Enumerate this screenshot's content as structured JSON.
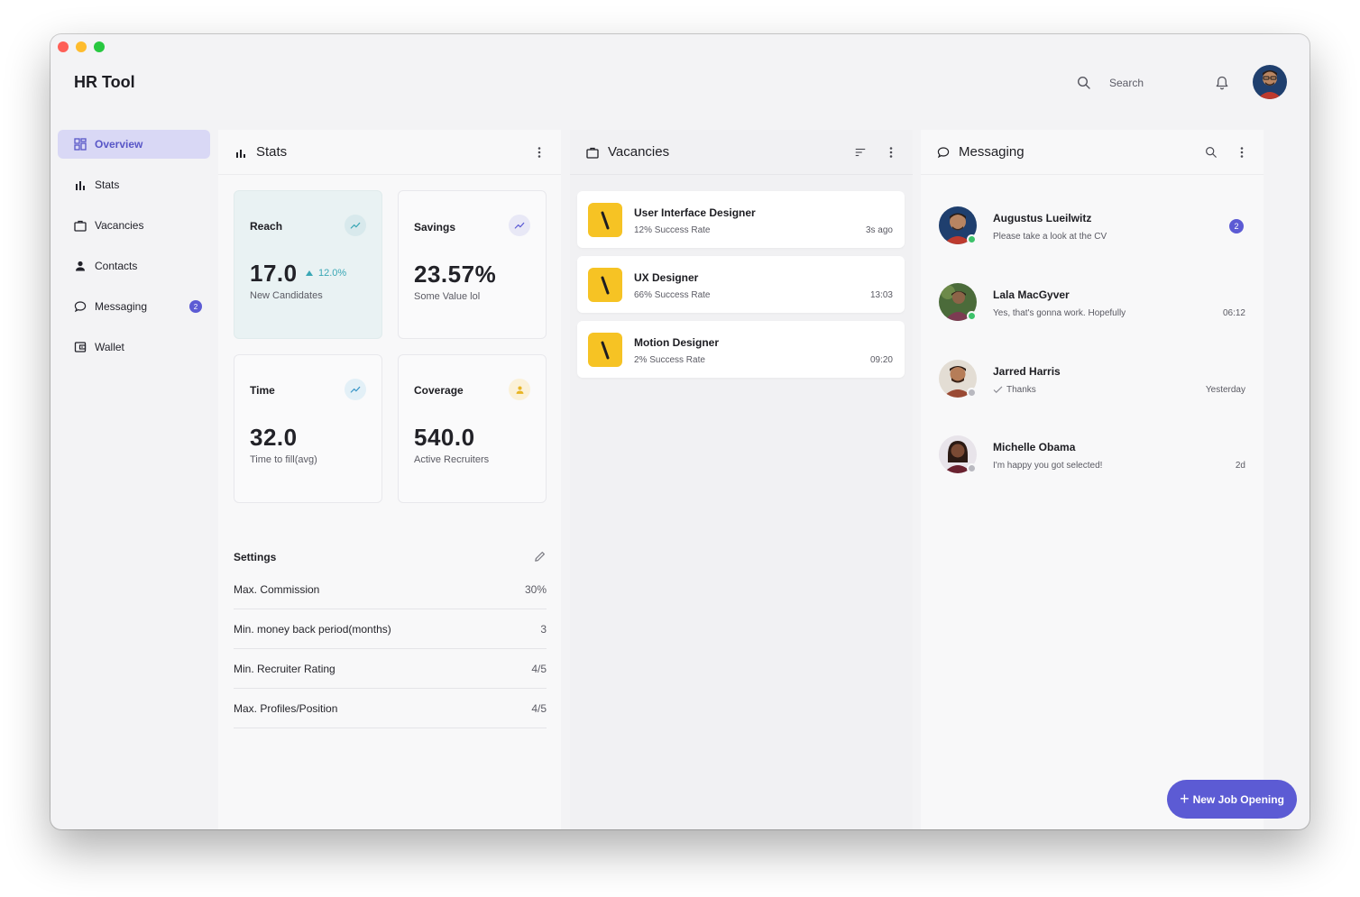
{
  "app": {
    "title": "HR Tool",
    "search_placeholder": "Search"
  },
  "colors": {
    "accent": "#5c5bd4",
    "sidebar_active_bg": "#d9d8f5",
    "vacancy_logo": "#f6c324",
    "online": "#3cc26a",
    "offline": "#b9b9c0",
    "reach_bg": "#e9f2f3"
  },
  "sidebar": {
    "items": [
      {
        "label": "Overview",
        "icon": "dashboard-icon",
        "active": true
      },
      {
        "label": "Stats",
        "icon": "bar-chart-icon"
      },
      {
        "label": "Vacancies",
        "icon": "briefcase-icon"
      },
      {
        "label": "Contacts",
        "icon": "person-icon"
      },
      {
        "label": "Messaging",
        "icon": "chat-bubble-icon",
        "badge": "2"
      },
      {
        "label": "Wallet",
        "icon": "wallet-icon"
      }
    ]
  },
  "stats": {
    "title": "Stats",
    "cards": [
      {
        "label": "Reach",
        "value": "17.0",
        "delta": "12.0%",
        "sub": "New Candidates",
        "icon": "trending-up-icon"
      },
      {
        "label": "Savings",
        "value": "23.57%",
        "sub": "Some Value lol",
        "icon": "trending-up-icon"
      },
      {
        "label": "Time",
        "value": "32.0",
        "sub": "Time to fill(avg)",
        "icon": "trending-up-icon"
      },
      {
        "label": "Coverage",
        "value": "540.0",
        "sub": "Active Recruiters",
        "icon": "person-icon"
      }
    ],
    "settings": {
      "title": "Settings",
      "rows": [
        {
          "label": "Max. Commission",
          "value": "30%"
        },
        {
          "label": "Min. money back period(months)",
          "value": "3"
        },
        {
          "label": "Min. Recruiter Rating",
          "value": "4/5"
        },
        {
          "label": "Max. Profiles/Position",
          "value": "4/5"
        }
      ]
    }
  },
  "vacancies": {
    "title": "Vacancies",
    "items": [
      {
        "title": "User Interface Designer",
        "rate": "12% Success Rate",
        "time": "3s ago"
      },
      {
        "title": "UX Designer",
        "rate": "66% Success Rate",
        "time": "13:03"
      },
      {
        "title": "Motion Designer",
        "rate": "2% Success Rate",
        "time": "09:20"
      }
    ]
  },
  "messaging": {
    "title": "Messaging",
    "items": [
      {
        "name": "Augustus Lueilwitz",
        "text": "Please take a look at the CV",
        "time": "",
        "badge": "2",
        "online": true
      },
      {
        "name": "Lala MacGyver",
        "text": "Yes, that's gonna work. Hopefully",
        "time": "06:12",
        "online": true
      },
      {
        "name": "Jarred Harris",
        "text": "Thanks",
        "time": "Yesterday",
        "online": false,
        "read": true
      },
      {
        "name": "Michelle Obama",
        "text": "I'm happy you got selected!",
        "time": "2d",
        "online": false
      }
    ]
  },
  "fab": {
    "label": "New Job Opening"
  }
}
